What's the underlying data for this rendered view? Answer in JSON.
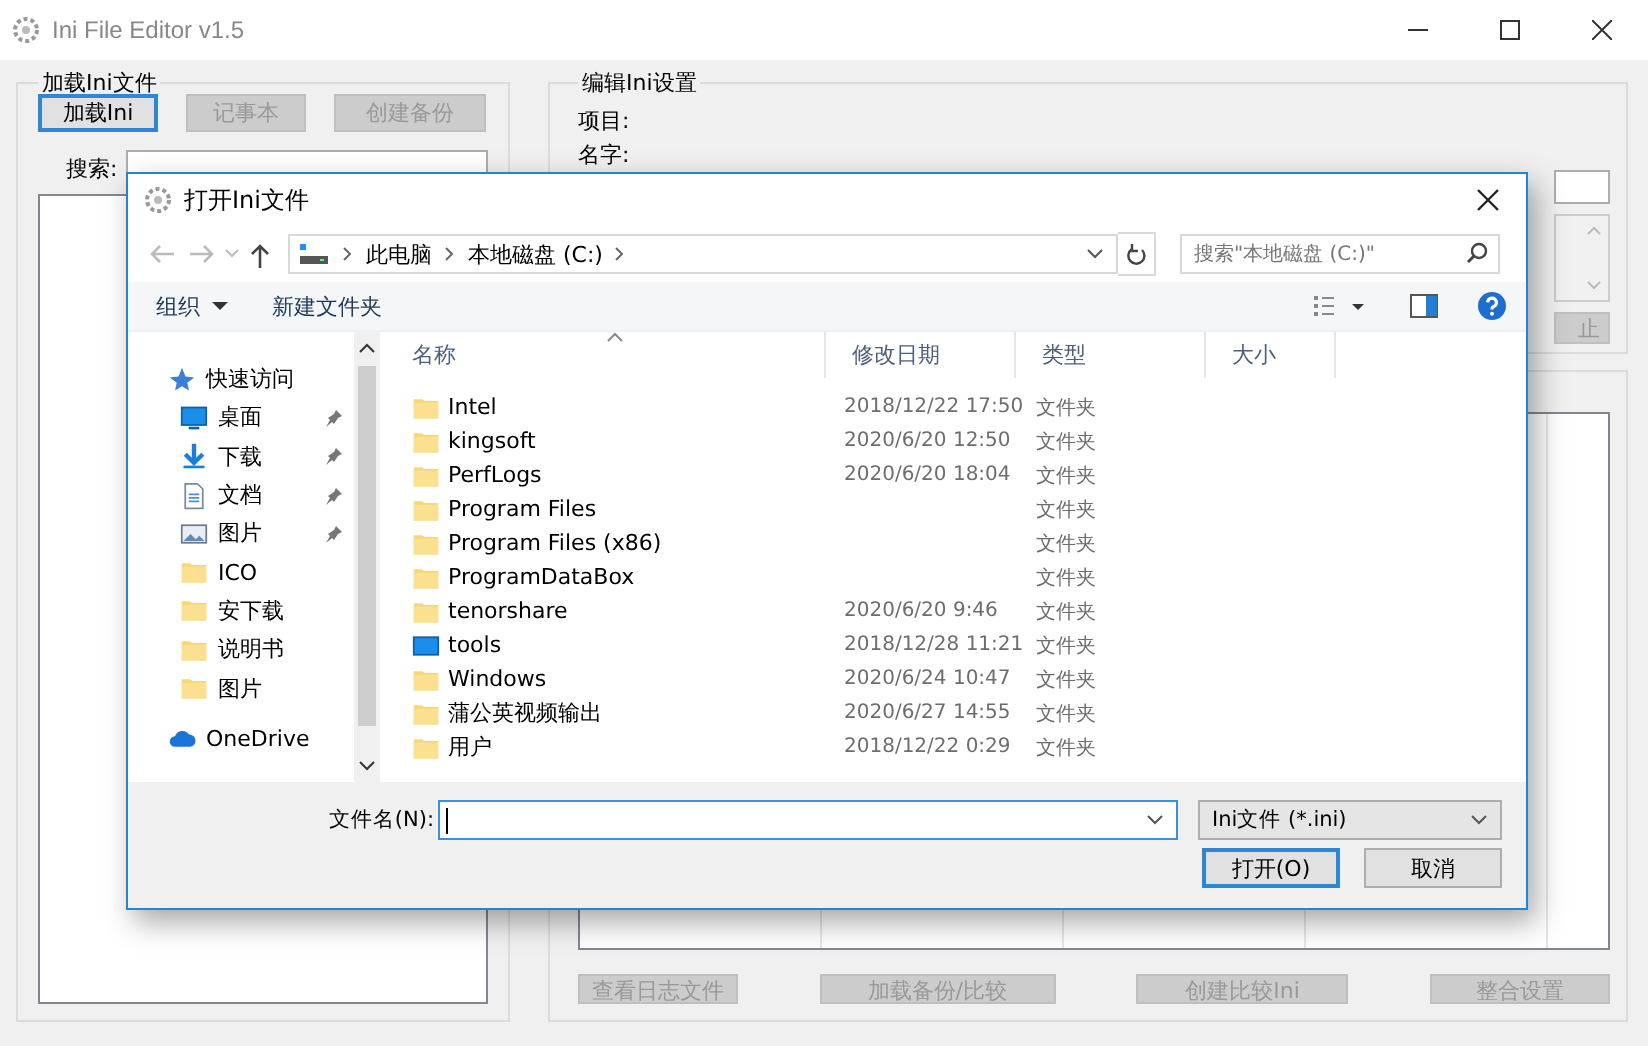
{
  "window": {
    "title": "Ini File Editor v1.5"
  },
  "load_group": {
    "title": "加载Ini文件",
    "search_label": "搜索:",
    "buttons": [
      {
        "label": "加载Ini",
        "disabled": false,
        "focused": true
      },
      {
        "label": "记事本",
        "disabled": true,
        "focused": false
      },
      {
        "label": "创建备份",
        "disabled": true,
        "focused": false
      }
    ]
  },
  "edit_group": {
    "title": "编辑Ini设置",
    "labels": [
      "项目:",
      "名字:"
    ],
    "button": {
      "label": "止",
      "disabled": true
    }
  },
  "bottom_buttons": [
    {
      "label": "查看日志文件",
      "disabled": true
    },
    {
      "label": "加载备份/比较",
      "disabled": true
    },
    {
      "label": "创建比较Ini",
      "disabled": true
    },
    {
      "label": "整合设置",
      "disabled": true
    }
  ],
  "dialog": {
    "title": "打开Ini文件",
    "path": [
      "此电脑",
      "本地磁盘 (C:)"
    ],
    "search": {
      "placeholder": "搜索\"本地磁盘 (C:)\""
    },
    "toolbar": [
      {
        "label": "组织",
        "dropdown": true
      },
      {
        "label": "新建文件夹",
        "dropdown": false
      }
    ],
    "nav": [
      {
        "label": "快速访问",
        "kind": "star",
        "pinned": false
      },
      {
        "label": "桌面",
        "kind": "desktop",
        "pinned": true
      },
      {
        "label": "下载",
        "kind": "download",
        "pinned": true
      },
      {
        "label": "文档",
        "kind": "document",
        "pinned": true
      },
      {
        "label": "图片",
        "kind": "picture",
        "pinned": true
      },
      {
        "label": "ICO",
        "kind": "folder",
        "pinned": false
      },
      {
        "label": "安下载",
        "kind": "folder",
        "pinned": false
      },
      {
        "label": "说明书",
        "kind": "folder",
        "pinned": false
      },
      {
        "label": "图片",
        "kind": "folder",
        "pinned": false
      },
      {
        "label": "OneDrive",
        "kind": "cloud",
        "pinned": false
      }
    ],
    "columns": [
      "名称",
      "修改日期",
      "类型",
      "大小"
    ],
    "rows": [
      {
        "name": "Intel",
        "date": "2018/12/22 17:50",
        "type": "文件夹",
        "kind": "folder"
      },
      {
        "name": "kingsoft",
        "date": "2020/6/20 12:50",
        "type": "文件夹",
        "kind": "folder"
      },
      {
        "name": "PerfLogs",
        "date": "2020/6/20 18:04",
        "type": "文件夹",
        "kind": "folder"
      },
      {
        "name": "Program Files",
        "type": "文件夹",
        "kind": "folder"
      },
      {
        "name": "Program Files (x86)",
        "type": "文件夹",
        "kind": "folder"
      },
      {
        "name": "ProgramDataBox",
        "type": "文件夹",
        "kind": "folder"
      },
      {
        "name": "tenorshare",
        "date": "2020/6/20 9:46",
        "type": "文件夹",
        "kind": "folder"
      },
      {
        "name": "tools",
        "date": "2018/12/28 11:21",
        "type": "文件夹",
        "kind": "drive"
      },
      {
        "name": "Windows",
        "date": "2020/6/24 10:47",
        "type": "文件夹",
        "kind": "folder"
      },
      {
        "name": "蒲公英视频输出",
        "date": "2020/6/27 14:55",
        "type": "文件夹",
        "kind": "folder"
      },
      {
        "name": "用户",
        "date": "2018/12/22 0:29",
        "type": "文件夹",
        "kind": "folder"
      }
    ],
    "filename_label": "文件名(N):",
    "filter": "Ini文件 (*.ini)",
    "buttons": [
      {
        "label": "打开(O)",
        "default": true
      },
      {
        "label": "取消",
        "default": false
      }
    ]
  }
}
